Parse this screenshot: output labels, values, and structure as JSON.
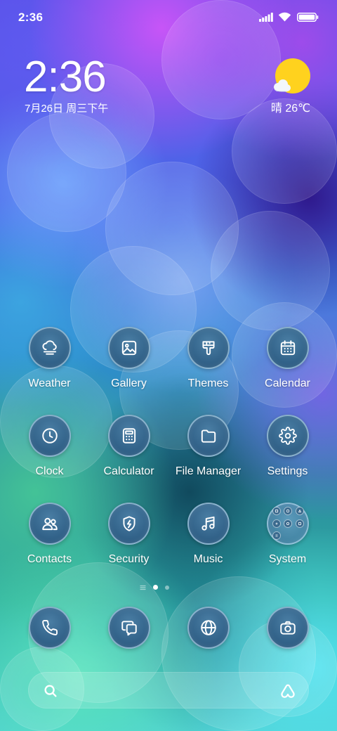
{
  "status_bar": {
    "time": "2:36",
    "signal_level": 5,
    "signal_max": 5,
    "battery_level": 1.0,
    "icons": [
      "signal-icon",
      "wifi-icon",
      "battery-icon"
    ]
  },
  "clock_widget": {
    "time": "2:36",
    "date": "7月26日 周三下午"
  },
  "weather_widget": {
    "icon": "sun-cloud-icon",
    "condition_temp": "晴 26℃"
  },
  "home_grid": {
    "apps": [
      {
        "label": "Weather",
        "icon": "weather-icon"
      },
      {
        "label": "Gallery",
        "icon": "gallery-icon"
      },
      {
        "label": "Themes",
        "icon": "themes-brush-icon"
      },
      {
        "label": "Calendar",
        "icon": "calendar-icon"
      },
      {
        "label": "Clock",
        "icon": "clock-icon"
      },
      {
        "label": "Calculator",
        "icon": "calculator-icon"
      },
      {
        "label": "File Manager",
        "icon": "folder-icon"
      },
      {
        "label": "Settings",
        "icon": "gear-icon"
      },
      {
        "label": "Contacts",
        "icon": "contacts-icon"
      },
      {
        "label": "Security",
        "icon": "shield-icon"
      },
      {
        "label": "Music",
        "icon": "music-note-icon"
      },
      {
        "label": "System",
        "icon": "app-folder-icon"
      }
    ]
  },
  "page_indicator": {
    "icon": "menu-lines-icon",
    "page_count": 2,
    "active_index": 0
  },
  "dock": {
    "apps": [
      {
        "icon": "phone-icon"
      },
      {
        "icon": "messages-icon"
      },
      {
        "icon": "browser-globe-icon"
      },
      {
        "icon": "camera-icon"
      }
    ]
  },
  "search_bar": {
    "left_icon": "search-icon",
    "right_icon": "assistant-icon"
  },
  "colors": {
    "label_text": "#ffffff",
    "icon_circle": "#2f5f86",
    "icon_ring": "#c3e4f6",
    "weather_sun": "#ffd21e",
    "active_dot": "#ffffff",
    "inactive_dot": "#a8c0d4"
  }
}
